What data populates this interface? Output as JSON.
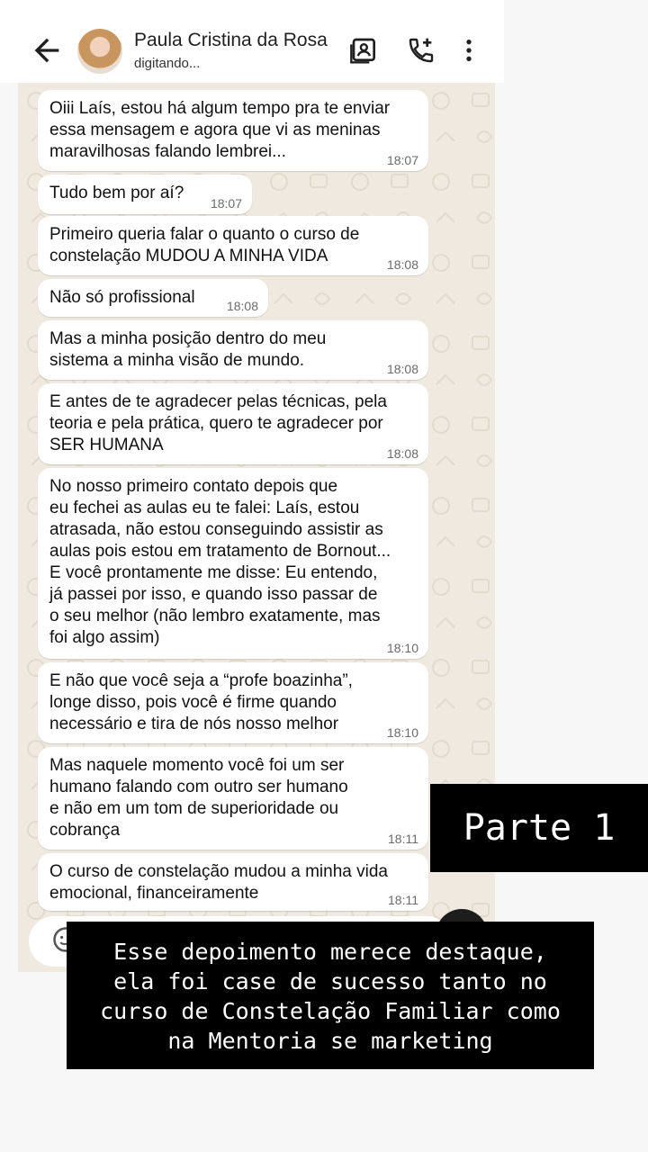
{
  "header": {
    "contact_name": "Paula Cristina da Rosa",
    "status": "digitando...",
    "icons": [
      "back-arrow-icon",
      "avatar",
      "contact-card-icon",
      "add-call-icon",
      "more-vert-icon"
    ]
  },
  "messages": [
    {
      "text": "Oiii Laís, estou há algum tempo pra te enviar\nessa mensagem e agora que vi as meninas\nmaravilhosas falando lembrei...",
      "time": "18:07"
    },
    {
      "text": "Tudo bem por aí?",
      "time": "18:07"
    },
    {
      "text": "Primeiro queria falar o quanto o curso de\nconstelação MUDOU A MINHA VIDA",
      "time": "18:08"
    },
    {
      "text": "Não só profissional",
      "time": "18:08"
    },
    {
      "text": "Mas a minha posição dentro do meu\nsistema a minha visão de mundo.",
      "time": "18:08"
    },
    {
      "text": "E antes de te agradecer pelas técnicas, pela\nteoria e pela prática, quero te agradecer por\nSER HUMANA",
      "time": "18:08"
    },
    {
      "text": "No nosso primeiro contato depois que\neu fechei as aulas eu te falei: Laís, estou\natrasada, não estou conseguindo assistir as\naulas pois estou em tratamento de Bornout...\nE você prontamente me disse: Eu entendo,\njá passei por isso, e quando isso passar de\no seu melhor (não lembro exatamente, mas\nfoi algo assim)",
      "time": "18:10"
    },
    {
      "text": "E não que você seja a “profe boazinha”,\nlonge disso, pois você é firme quando\nnecessário e tira de nós nosso melhor",
      "time": "18:10"
    },
    {
      "text": "Mas naquele momento você foi um ser\nhumano falando com outro ser humano\ne não em um tom de superioridade ou\ncobrança",
      "time": "18:11"
    },
    {
      "text": "O curso de constelação mudou a minha vida\nemocional, financeiramente",
      "time": "18:11"
    }
  ],
  "overlay": {
    "parte": "Parte 1",
    "caption": "Esse depoimento merece destaque,\nela foi case de sucesso tanto no\ncurso de Constelação Familiar como\nna Mentoria se marketing"
  }
}
